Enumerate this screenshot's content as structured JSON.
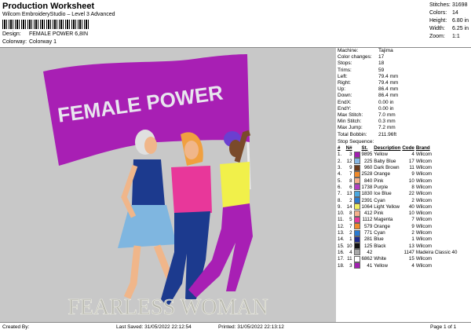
{
  "header": {
    "title": "Production Worksheet",
    "subtitle": "Wilcom EmbroideryStudio – Level 3 Advanced",
    "design_label": "Design:",
    "design_value": "FEMALE POWER 6,8IN",
    "colorway_label": "Colorway:",
    "colorway_value": "Colorway 1"
  },
  "stats": {
    "stitches_label": "Stitches:",
    "stitches": "31698",
    "colors_label": "Colors:",
    "colors": "14",
    "height_label": "Height:",
    "height": "6.80 in",
    "width_label": "Width:",
    "width": "6.25 in",
    "zoom_label": "Zoom:",
    "zoom": "1:1"
  },
  "design": {
    "banner_text": "FEMALE POWER",
    "bottom_text": "FEARLESS WOMAN",
    "colors": {
      "purple": "#a81fb4",
      "banner_text": "#e8e6ee",
      "pink": "#e8379a",
      "blue": "#1c3a8e",
      "lightblue": "#7fb6e0",
      "yellow": "#f1f04a",
      "skin": "#f0b68a",
      "dark_skin": "#7a4a2a",
      "gray_hair": "#e0e0e0",
      "orange_hair": "#f0a040",
      "text_gray": "#b9b9b0"
    }
  },
  "machine": [
    {
      "k": "Machine:",
      "v": "Tajima"
    },
    {
      "k": "Color changes:",
      "v": "17"
    },
    {
      "k": "Stops:",
      "v": "18"
    },
    {
      "k": "Trims:",
      "v": "59"
    },
    {
      "k": "Left:",
      "v": "79.4 mm"
    },
    {
      "k": "Right:",
      "v": "79.4 mm"
    },
    {
      "k": "Up:",
      "v": "86.4 mm"
    },
    {
      "k": "Down:",
      "v": "86.4 mm"
    },
    {
      "k": "EndX:",
      "v": "0.00 in"
    },
    {
      "k": "EndY:",
      "v": "0.00 in"
    },
    {
      "k": "Max Stitch:",
      "v": "7.0 mm"
    },
    {
      "k": "Min Stitch:",
      "v": "0.3 mm"
    },
    {
      "k": "Max Jump:",
      "v": "7.2 mm"
    },
    {
      "k": "Total Bobbin:",
      "v": "211.96ft"
    }
  ],
  "stop_sequence_label": "Stop Sequence:",
  "seq_headers": {
    "n": "#",
    "n2": "N#",
    "st": "St.",
    "desc": "Description",
    "code": "Code",
    "brand": "Brand"
  },
  "sequence": [
    {
      "n": "1.",
      "n2": "3",
      "color": "#a21fb0",
      "st": "9895",
      "desc": "Yellow",
      "code": "4",
      "brand": "Wilcom"
    },
    {
      "n": "2.",
      "n2": "12",
      "color": "#86b8e6",
      "st": "225",
      "desc": "Baby Blue",
      "code": "17",
      "brand": "Wilcom"
    },
    {
      "n": "3.",
      "n2": "9",
      "color": "#6a3a1c",
      "st": "960",
      "desc": "Dark Brown",
      "code": "11",
      "brand": "Wilcom"
    },
    {
      "n": "4.",
      "n2": "7",
      "color": "#f08a2a",
      "st": "2528",
      "desc": "Orange",
      "code": "9",
      "brand": "Wilcom"
    },
    {
      "n": "5.",
      "n2": "8",
      "color": "#f4b08c",
      "st": "840",
      "desc": "Pink",
      "code": "10",
      "brand": "Wilcom"
    },
    {
      "n": "6.",
      "n2": "6",
      "color": "#b23ec0",
      "st": "1738",
      "desc": "Purple",
      "code": "8",
      "brand": "Wilcom"
    },
    {
      "n": "7.",
      "n2": "13",
      "color": "#4aa8e0",
      "st": "1830",
      "desc": "Ice Blue",
      "code": "22",
      "brand": "Wilcom"
    },
    {
      "n": "8.",
      "n2": "2",
      "color": "#2a7ad0",
      "st": "2391",
      "desc": "Cyan",
      "code": "2",
      "brand": "Wilcom"
    },
    {
      "n": "9.",
      "n2": "14",
      "color": "#f0ee60",
      "st": "1064",
      "desc": "Light Yellow",
      "code": "40",
      "brand": "Wilcom"
    },
    {
      "n": "10.",
      "n2": "8",
      "color": "#f4b08c",
      "st": "412",
      "desc": "Pink",
      "code": "10",
      "brand": "Wilcom"
    },
    {
      "n": "11.",
      "n2": "5",
      "color": "#e8389a",
      "st": "1112",
      "desc": "Magenta",
      "code": "7",
      "brand": "Wilcom"
    },
    {
      "n": "12.",
      "n2": "7",
      "color": "#f08a2a",
      "st": "579",
      "desc": "Orange",
      "code": "9",
      "brand": "Wilcom"
    },
    {
      "n": "13.",
      "n2": "2",
      "color": "#2a7ad0",
      "st": "771",
      "desc": "Cyan",
      "code": "2",
      "brand": "Wilcom"
    },
    {
      "n": "14.",
      "n2": "1",
      "color": "#1c2a8a",
      "st": "281",
      "desc": "Blue",
      "code": "1",
      "brand": "Wilcom"
    },
    {
      "n": "15.",
      "n2": "10",
      "color": "#111111",
      "st": "125",
      "desc": "Black",
      "code": "13",
      "brand": "Wilcom"
    },
    {
      "n": "16.",
      "n2": "4",
      "color": "#a8a8a8",
      "st": "42",
      "desc": "",
      "code": "1147",
      "brand": "Madeira Classic 40"
    },
    {
      "n": "17.",
      "n2": "11",
      "color": "#ffffff",
      "st": "6862",
      "desc": "White",
      "code": "15",
      "brand": "Wilcom"
    },
    {
      "n": "18.",
      "n2": "3",
      "color": "#a21fb0",
      "st": "41",
      "desc": "Yellow",
      "code": "4",
      "brand": "Wilcom"
    }
  ],
  "footer": {
    "created": "Created By:",
    "saved": "Last Saved: 31/05/2022 22:12:54",
    "printed": "Printed: 31/05/2022 22:13:12",
    "page": "Page 1 of 1"
  }
}
